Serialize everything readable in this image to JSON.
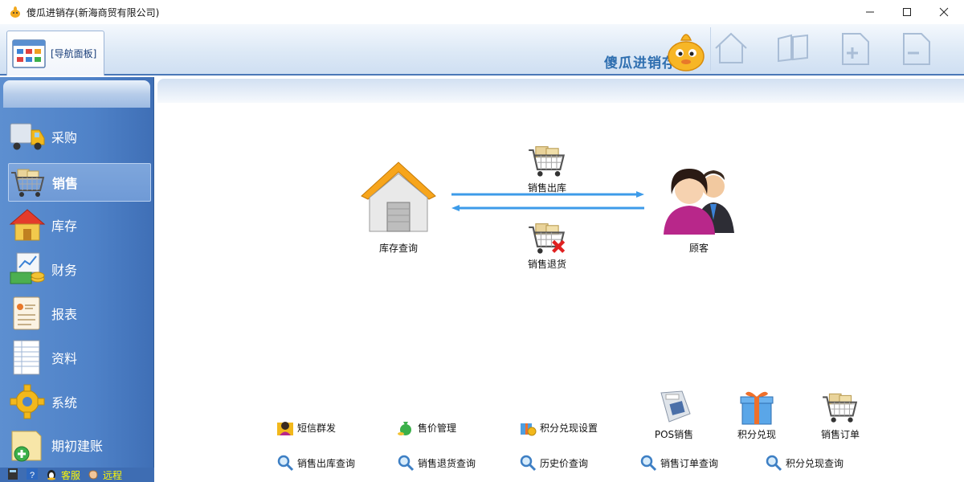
{
  "window": {
    "title": "傻瓜进销存(新海商贸有限公司)",
    "controls": {
      "minimize": "minimize-icon",
      "maximize": "maximize-icon",
      "close": "close-icon"
    }
  },
  "toolbar": {
    "nav_tab_label": "[导航面板]",
    "brand": "傻瓜进销存",
    "buttons": [
      "home-icon",
      "windows-icon",
      "add-window-icon",
      "remove-window-icon"
    ]
  },
  "sidebar": {
    "items": [
      {
        "label": "采购",
        "icon": "truck-icon"
      },
      {
        "label": "销售",
        "icon": "cart-icon"
      },
      {
        "label": "库存",
        "icon": "house-icon"
      },
      {
        "label": "财务",
        "icon": "money-icon"
      },
      {
        "label": "报表",
        "icon": "report-icon"
      },
      {
        "label": "资料",
        "icon": "document-icon"
      },
      {
        "label": "系统",
        "icon": "gear-icon"
      },
      {
        "label": "期初建账",
        "icon": "folder-add-icon"
      }
    ],
    "active_index": 1,
    "footer": {
      "service": "客服",
      "remote": "远程"
    }
  },
  "flow": {
    "warehouse": "库存查询",
    "out": "销售出库",
    "ret": "销售退货",
    "customer": "顾客"
  },
  "quick_links": {
    "row1": [
      "短信群发",
      "售价管理",
      "积分兑现设置"
    ],
    "big": [
      "POS销售",
      "积分兑现",
      "销售订单"
    ],
    "row2": [
      "销售出库查询",
      "销售退货查询",
      "历史价查询",
      "销售订单查询",
      "积分兑现查询"
    ]
  },
  "colors": {
    "accent": "#4a78b8",
    "sidebar": "#4f82c8",
    "arrow": "#3d9be9",
    "footer_text": "#fff800"
  }
}
